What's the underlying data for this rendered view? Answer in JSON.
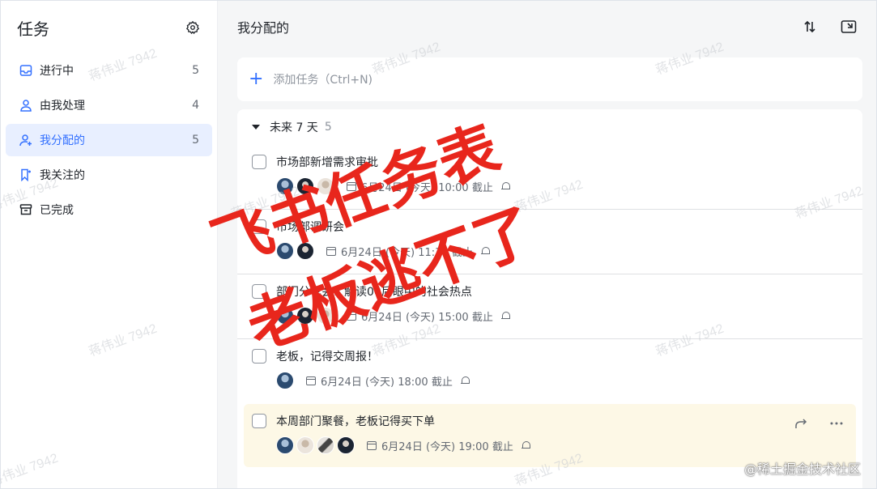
{
  "sidebar": {
    "title": "任务",
    "items": [
      {
        "label": "进行中",
        "count": "5"
      },
      {
        "label": "由我处理",
        "count": "4"
      },
      {
        "label": "我分配的",
        "count": "5"
      },
      {
        "label": "我关注的",
        "count": ""
      },
      {
        "label": "已完成",
        "count": ""
      }
    ]
  },
  "main": {
    "title": "我分配的",
    "add_placeholder": "添加任务（Ctrl+N)",
    "group": {
      "label": "未来 7 天",
      "count": "5"
    },
    "tasks": [
      {
        "title": "市场部新增需求审批",
        "due": "6月24日 (今天) 10:00 截止"
      },
      {
        "title": "市场部调研会",
        "due": "6月24日 (今天) 11:30 截止"
      },
      {
        "title": "部门分享会：解读00后眼中的社会热点",
        "due": "6月24日 (今天) 15:00 截止"
      },
      {
        "title": "老板，记得交周报！",
        "due": "6月24日 (今天) 18:00 截止"
      },
      {
        "title": "本周部门聚餐，老板记得买下单",
        "due": "6月24日 (今天) 19:00 截止"
      }
    ]
  },
  "overlay": {
    "line1": "飞书任务表",
    "line2": "老板逃不了",
    "watermark": "蒋伟业 7942",
    "footer": "@稀土掘金技术社区"
  },
  "colors": {
    "accent": "#3370ff",
    "overlay_red": "#e8261c",
    "highlight": "#fdf8e6"
  }
}
